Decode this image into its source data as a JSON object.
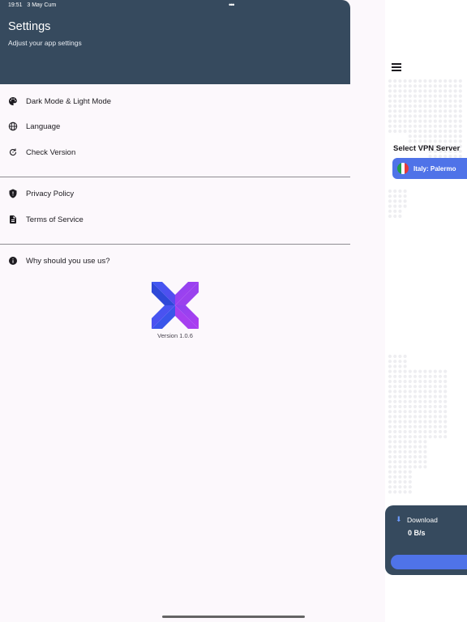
{
  "status_bar": {
    "time": "19:51",
    "date": "3 May Cum",
    "dots": "•••"
  },
  "header": {
    "title": "Settings",
    "subtitle": "Adjust your app settings"
  },
  "sections": [
    {
      "items": [
        {
          "label": "Dark Mode & Light Mode",
          "icon": "palette-icon"
        },
        {
          "label": "Language",
          "icon": "globe-icon"
        },
        {
          "label": "Check Version",
          "icon": "refresh-icon"
        }
      ]
    },
    {
      "items": [
        {
          "label": "Privacy Policy",
          "icon": "shield-icon"
        },
        {
          "label": "Terms of Service",
          "icon": "document-icon"
        }
      ]
    },
    {
      "items": [
        {
          "label": "Why should you use us?",
          "icon": "info-icon"
        }
      ]
    }
  ],
  "version": "Version 1.0.6",
  "background_app": {
    "select_label": "Select VPN Server",
    "server": "Italy: Palermo",
    "download_label": "Download",
    "download_value": "0 B/s"
  },
  "colors": {
    "header": "#364a5e",
    "accent": "#4f73e8",
    "logo_blue": "#3d5af1",
    "logo_purple": "#a43df0"
  }
}
